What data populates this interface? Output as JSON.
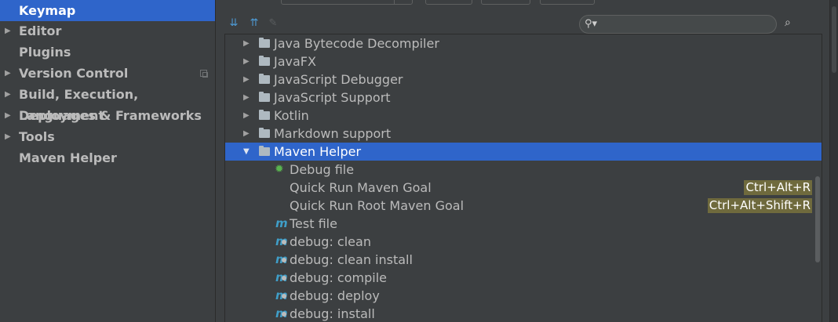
{
  "sidebar": {
    "items": [
      {
        "label": "Keymap",
        "expandable": false,
        "selected": true
      },
      {
        "label": "Editor",
        "expandable": true
      },
      {
        "label": "Plugins",
        "expandable": false
      },
      {
        "label": "Version Control",
        "expandable": true,
        "has_copy_icon": true
      },
      {
        "label": "Build, Execution, Deployment",
        "expandable": true
      },
      {
        "label": "Languages & Frameworks",
        "expandable": true
      },
      {
        "label": "Tools",
        "expandable": true
      },
      {
        "label": "Maven Helper",
        "expandable": false
      }
    ]
  },
  "toolbar": {
    "expand_all_icon": "expand-all-icon",
    "collapse_all_icon": "collapse-all-icon",
    "edit_icon": "pencil-icon",
    "search_placeholder": "",
    "search_value": "",
    "find_by_shortcut_icon": "find-shortcut-icon"
  },
  "tree": {
    "rows": [
      {
        "type": "folder",
        "label": "Java Bytecode Decompiler",
        "expanded": false
      },
      {
        "type": "folder",
        "label": "JavaFX",
        "expanded": false
      },
      {
        "type": "folder",
        "label": "JavaScript Debugger",
        "expanded": false
      },
      {
        "type": "folder",
        "label": "JavaScript Support",
        "expanded": false
      },
      {
        "type": "folder",
        "label": "Kotlin",
        "expanded": false
      },
      {
        "type": "folder",
        "label": "Markdown support",
        "expanded": false
      },
      {
        "type": "folder",
        "label": "Maven Helper",
        "expanded": true,
        "selected": true
      },
      {
        "type": "action",
        "icon": "gear-icon",
        "label": "Debug file"
      },
      {
        "type": "action",
        "icon": "none",
        "label": "Quick Run Maven Goal",
        "shortcut": "Ctrl+Alt+R"
      },
      {
        "type": "action",
        "icon": "none",
        "label": "Quick Run Root Maven Goal",
        "shortcut": "Ctrl+Alt+Shift+R"
      },
      {
        "type": "action",
        "icon": "maven-icon",
        "label": "Test file"
      },
      {
        "type": "action",
        "icon": "maven-debug-icon",
        "label": "debug: clean"
      },
      {
        "type": "action",
        "icon": "maven-debug-icon",
        "label": "debug: clean install"
      },
      {
        "type": "action",
        "icon": "maven-debug-icon",
        "label": "debug: compile"
      },
      {
        "type": "action",
        "icon": "maven-debug-icon",
        "label": "debug: deploy"
      },
      {
        "type": "action",
        "icon": "maven-debug-icon",
        "label": "debug: install"
      }
    ]
  },
  "colors": {
    "selection": "#2f65ca",
    "background": "#3c3f41",
    "text": "#bbbbbb",
    "shortcut_highlight": "#6f6a3d",
    "maven_icon": "#3f9ec8",
    "gear_icon": "#59b34f"
  }
}
